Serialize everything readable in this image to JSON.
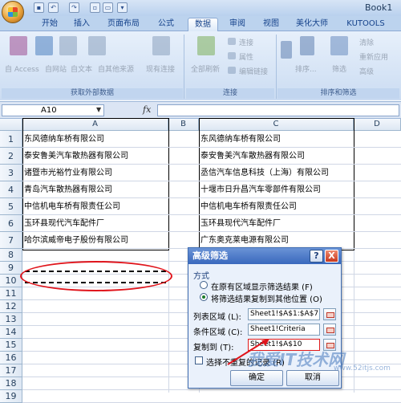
{
  "window": {
    "title": "Book1"
  },
  "ribbon_tabs": [
    "开始",
    "插入",
    "页面布局",
    "公式",
    "数据",
    "审阅",
    "视图",
    "美化大师",
    "KUTOOLS"
  ],
  "active_tab": "数据",
  "ribbon": {
    "external": {
      "access": "自 Access",
      "web": "自网站",
      "text": "自文本",
      "other": "自其他来源",
      "existing": "现有连接",
      "label": "获取外部数据"
    },
    "connections": {
      "refresh": "全部刷新",
      "connect": "连接",
      "props": "属性",
      "edit": "编辑链接",
      "label": "连接"
    },
    "sort": {
      "sort": "排序...",
      "filter": "筛选",
      "clear": "清除",
      "reapply": "重新应用",
      "advanced": "高级",
      "label": "排序和筛选"
    }
  },
  "formula_bar": {
    "name_box": "A10",
    "fx": "fx",
    "value": ""
  },
  "columns": [
    "A",
    "B",
    "C",
    "D"
  ],
  "rows": [
    "1",
    "2",
    "3",
    "4",
    "5",
    "6",
    "7",
    "8",
    "9",
    "10",
    "11",
    "12",
    "13",
    "14",
    "15",
    "16",
    "17",
    "18",
    "19"
  ],
  "col_a": [
    "东风德纳车桥有限公司",
    "泰安鲁美汽车散热器有限公司",
    "诸暨市光裕竹业有限公司",
    "青岛汽车散热器有限公司",
    "中信机电车桥有限责任公司",
    "玉环县现代汽车配件厂",
    "哈尔滨威帝电子股份有限公司"
  ],
  "col_c": [
    "东风德纳车桥有限公司",
    "泰安鲁美汽车散热器有限公司",
    "丞信汽车信息科技（上海）有限公司",
    "十堰市日升昌汽车零部件有限公司",
    "中信机电车桥有限责任公司",
    "玉环县现代汽车配件厂",
    "广东奥克莱电源有限公司"
  ],
  "dialog": {
    "title": "高级筛选",
    "help": "?",
    "close": "X",
    "method_label": "方式",
    "option1": "在原有区域显示筛选结果 (F)",
    "option2": "将筛选结果复制到其他位置 (O)",
    "list_range_label": "列表区域 (L):",
    "list_range_value": "Sheet1!$A$1:$A$7",
    "criteria_label": "条件区域 (C):",
    "criteria_value": "Sheet1!Criteria",
    "copy_to_label": "复制到 (T):",
    "copy_to_value": "Sheet1!$A$10",
    "unique_label": "选择不重复的记录 (R)",
    "ok": "确定",
    "cancel": "取消"
  },
  "watermark": {
    "text": "我爱IT技术网",
    "url": "www.52itjs.com"
  }
}
